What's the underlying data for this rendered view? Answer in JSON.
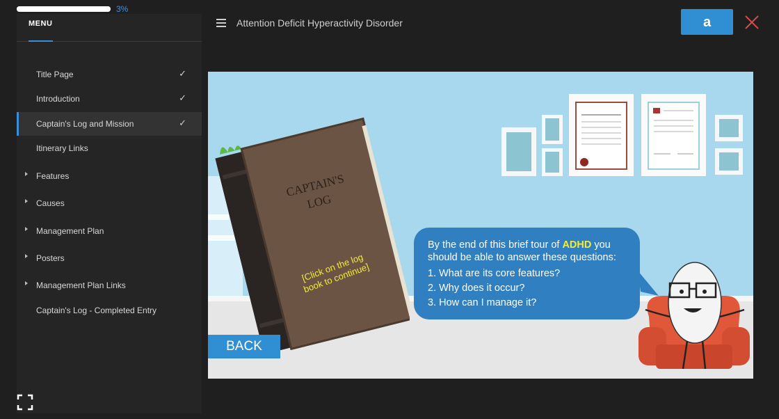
{
  "progress": {
    "percent_text": "3%",
    "fraction": 0.03
  },
  "menu": {
    "title": "MENU",
    "items": [
      {
        "label": "Title Page",
        "completed": true,
        "expandable": false,
        "active": false
      },
      {
        "label": "Introduction",
        "completed": true,
        "expandable": false,
        "active": false
      },
      {
        "label": "Captain's Log and Mission",
        "completed": true,
        "expandable": false,
        "active": true
      },
      {
        "label": "Itinerary Links",
        "completed": false,
        "expandable": false,
        "active": false
      },
      {
        "label": "Features",
        "completed": false,
        "expandable": true,
        "active": false
      },
      {
        "label": "Causes",
        "completed": false,
        "expandable": true,
        "active": false
      },
      {
        "label": "Management Plan",
        "completed": false,
        "expandable": true,
        "active": false
      },
      {
        "label": "Posters",
        "completed": false,
        "expandable": true,
        "active": false
      },
      {
        "label": "Management Plan Links",
        "completed": false,
        "expandable": true,
        "active": false
      },
      {
        "label": "Captain's Log - Completed Entry",
        "completed": false,
        "expandable": false,
        "active": false
      }
    ],
    "check_glyph": "✓"
  },
  "header": {
    "title": "Attention Deficit Hyperactivity Disorder",
    "a_button_label": "a"
  },
  "slide": {
    "book_title_line1": "CAPTAIN'S",
    "book_title_line2": "LOG",
    "book_hint_line1": "[Click on the log",
    "book_hint_line2": "book to continue]",
    "bubble_intro_before": "By the end of this brief tour of ",
    "bubble_highlight": "ADHD",
    "bubble_intro_after": " you should be able to answer these questions:",
    "questions": [
      "1.  What are its core features?",
      "2.  Why does it occur?",
      "3.  How can I manage it?"
    ],
    "back_label": "BACK"
  },
  "colors": {
    "accent": "#2f8fd2",
    "highlight": "#f3ec3d",
    "close": "#d94b4b",
    "slide_bg": "#a8d8ee"
  },
  "icons": [
    "hamburger-icon",
    "check-icon",
    "caret-right-icon",
    "close-icon",
    "fullscreen-icon"
  ]
}
